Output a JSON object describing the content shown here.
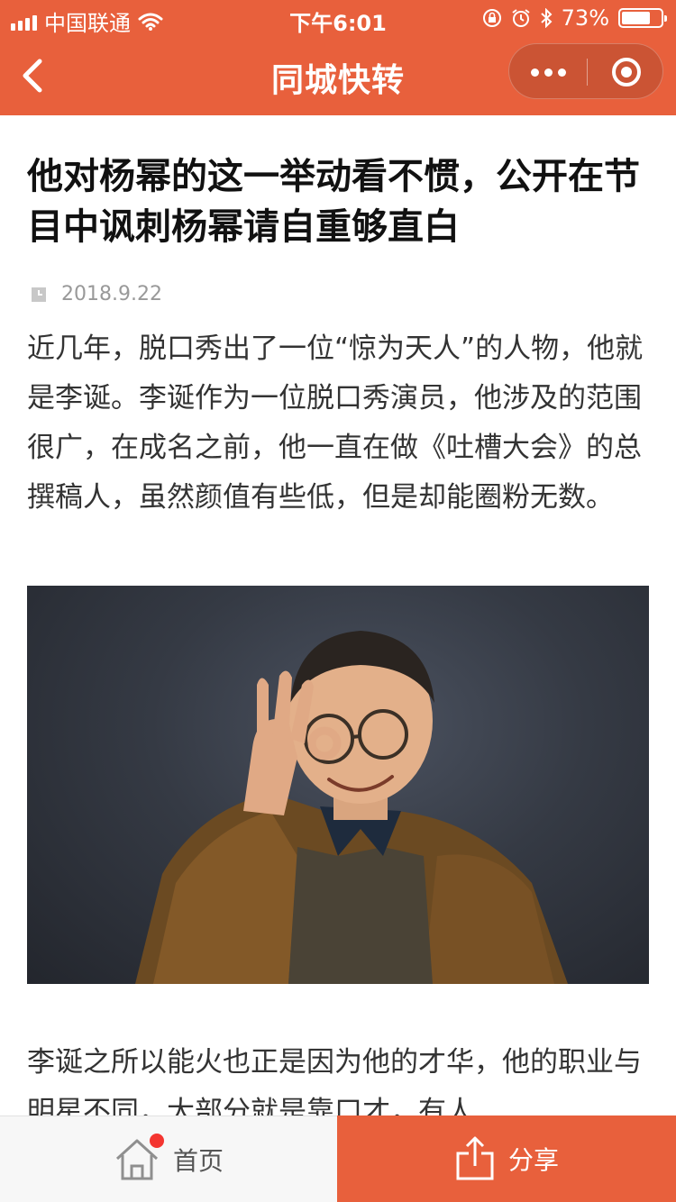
{
  "status_bar": {
    "carrier": "中国联通",
    "time": "下午6:01",
    "battery_text": "73%",
    "battery_level": 0.73
  },
  "nav": {
    "title": "同城快转"
  },
  "article": {
    "headline": "他对杨幂的这一举动看不惯，公开在节目中讽刺杨幂请自重够直白",
    "date": "2018.9.22",
    "paragraph1": "近几年，脱口秀出了一位“惊为天人”的人物，他就是李诞。李诞作为一位脱口秀演员，他涉及的范围很广，在成名之前，他一直在做《吐槽大会》的总撰稿人，虽然颜值有些低，但是却能圈粉无数。",
    "paragraph2": "李诞之所以能火也正是因为他的才华，他的职业与明星不同，大部分就是靠口才，有人"
  },
  "tabbar": {
    "home_label": "首页",
    "share_label": "分享"
  },
  "colors": {
    "brand": "#e8603c",
    "badge": "#f43530"
  },
  "icons": [
    "signal-icon",
    "wifi-icon",
    "lock-rotation-icon",
    "alarm-icon",
    "bluetooth-icon",
    "battery-icon",
    "back-icon",
    "more-icon",
    "close-target-icon",
    "clock-icon",
    "home-icon",
    "share-icon"
  ]
}
